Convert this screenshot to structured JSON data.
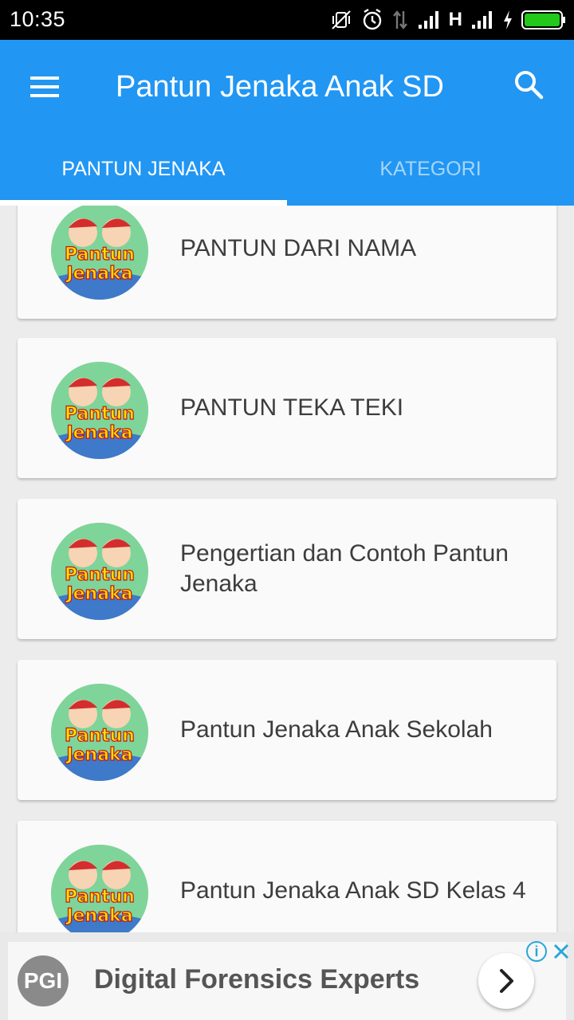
{
  "status_bar": {
    "time": "10:35",
    "network_type": "H",
    "icons": [
      "mute-vibrate-icon",
      "alarm-icon",
      "data-transfer-icon",
      "signal-icon",
      "signal-icon-2",
      "charging-icon",
      "battery-icon"
    ]
  },
  "app_bar": {
    "title": "Pantun Jenaka Anak SD",
    "menu_icon": "hamburger-menu-icon",
    "search_icon": "search-icon",
    "color": "#2196f3"
  },
  "tabs": [
    {
      "label": "PANTUN JENAKA",
      "selected": true
    },
    {
      "label": "KATEGORI",
      "selected": false
    }
  ],
  "list": {
    "items": [
      {
        "title": "PANTUN DARI NAMA"
      },
      {
        "title": "PANTUN TEKA TEKI"
      },
      {
        "title": "Pengertian dan Contoh Pantun Jenaka"
      },
      {
        "title": "Pantun Jenaka Anak Sekolah"
      },
      {
        "title": "Pantun Jenaka Anak SD Kelas 4"
      }
    ],
    "logo_text": {
      "line1": "Pantun",
      "line2": "Jenaka"
    }
  },
  "ad": {
    "logo_text": "PGI",
    "text": "Digital Forensics Experts",
    "info_label": "i"
  }
}
